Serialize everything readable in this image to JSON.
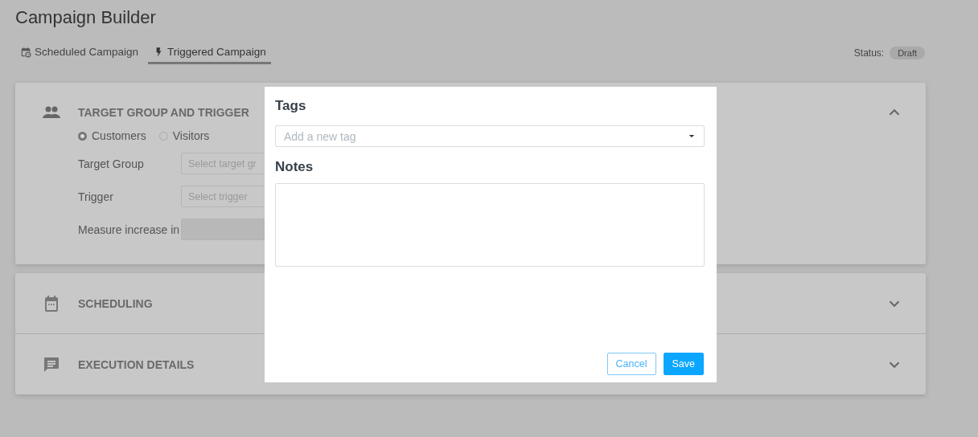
{
  "page": {
    "title": "Campaign Builder"
  },
  "tabs": [
    {
      "label": "Scheduled Campaign",
      "selected": false
    },
    {
      "label": "Triggered Campaign",
      "selected": true
    }
  ],
  "status": {
    "label": "Status:",
    "value": "Draft"
  },
  "sections": [
    {
      "title": "TARGET GROUP AND TRIGGER",
      "expanded": true,
      "audience": [
        {
          "label": "Customers",
          "selected": true
        },
        {
          "label": "Visitors",
          "selected": false
        }
      ],
      "fields": [
        {
          "label": "Target Group",
          "placeholder": "Select target gr",
          "disabled": false
        },
        {
          "label": "Trigger",
          "placeholder": "Select trigger",
          "disabled": false
        },
        {
          "label": "Measure increase in",
          "disabled": true
        }
      ]
    },
    {
      "title": "SCHEDULING",
      "expanded": false
    },
    {
      "title": "EXECUTION DETAILS",
      "expanded": false
    }
  ],
  "dialog": {
    "tags_label": "Tags",
    "tags_placeholder": "Add a new tag",
    "notes_label": "Notes",
    "buttons": [
      {
        "label": "Cancel",
        "kind": "secondary"
      },
      {
        "label": "Save",
        "kind": "primary"
      }
    ]
  }
}
